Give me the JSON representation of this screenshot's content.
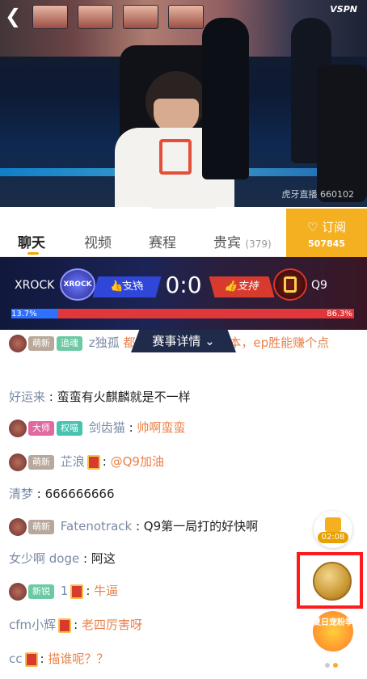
{
  "video": {
    "brand": "VSPN",
    "watermark": "虎牙直播 660102"
  },
  "tabs": [
    {
      "label": "聊天"
    },
    {
      "label": "视频"
    },
    {
      "label": "赛程"
    },
    {
      "label": "贵宾",
      "count": "(379)"
    }
  ],
  "subscribe": {
    "label": "♡ 订阅",
    "count": "507845"
  },
  "match": {
    "left_team": "XROCK",
    "left_logo_text": "XROCK",
    "right_team": "Q9",
    "support_label": "支持",
    "score": "0:0",
    "left_pct": "13.7%",
    "right_pct": "86.3%",
    "left_share": 0.137,
    "details_label": "赛事详情"
  },
  "chat": [
    {
      "level": "萌新",
      "tag": "追魂",
      "name": "z独孤",
      "text": "都是2比1 es胜能回本，ep胜能赚个点"
    },
    {
      "name": "好运来",
      "text": "蛮蛮有火麒麟就是不一样"
    },
    {
      "level": "大师",
      "tag": "权喵",
      "name": "剑齿猫",
      "text": "帅啊蛮蛮"
    },
    {
      "level": "萌新",
      "name": "芷浪",
      "text": "@Q9加油"
    },
    {
      "name": "清梦",
      "text": "666666666"
    },
    {
      "level": "萌新",
      "name": "Fatenotrack",
      "text": "Q9第一局打的好快啊"
    },
    {
      "name": "女少啊 doge",
      "text": "阿这"
    },
    {
      "level": "新锐",
      "name": "1",
      "text": "牛逼"
    },
    {
      "name": "cfm小辉",
      "text": "老四厉害呀"
    },
    {
      "name": "cc",
      "text": "描谁呢？？"
    }
  ],
  "widgets": {
    "chest_timer": "02:08",
    "summer_event": "夏日宠粉季"
  },
  "colors": {
    "accent": "#f5b022",
    "left_team": "#2f70ff",
    "right_team": "#e0373a",
    "highlight": "#ff1b1b"
  }
}
